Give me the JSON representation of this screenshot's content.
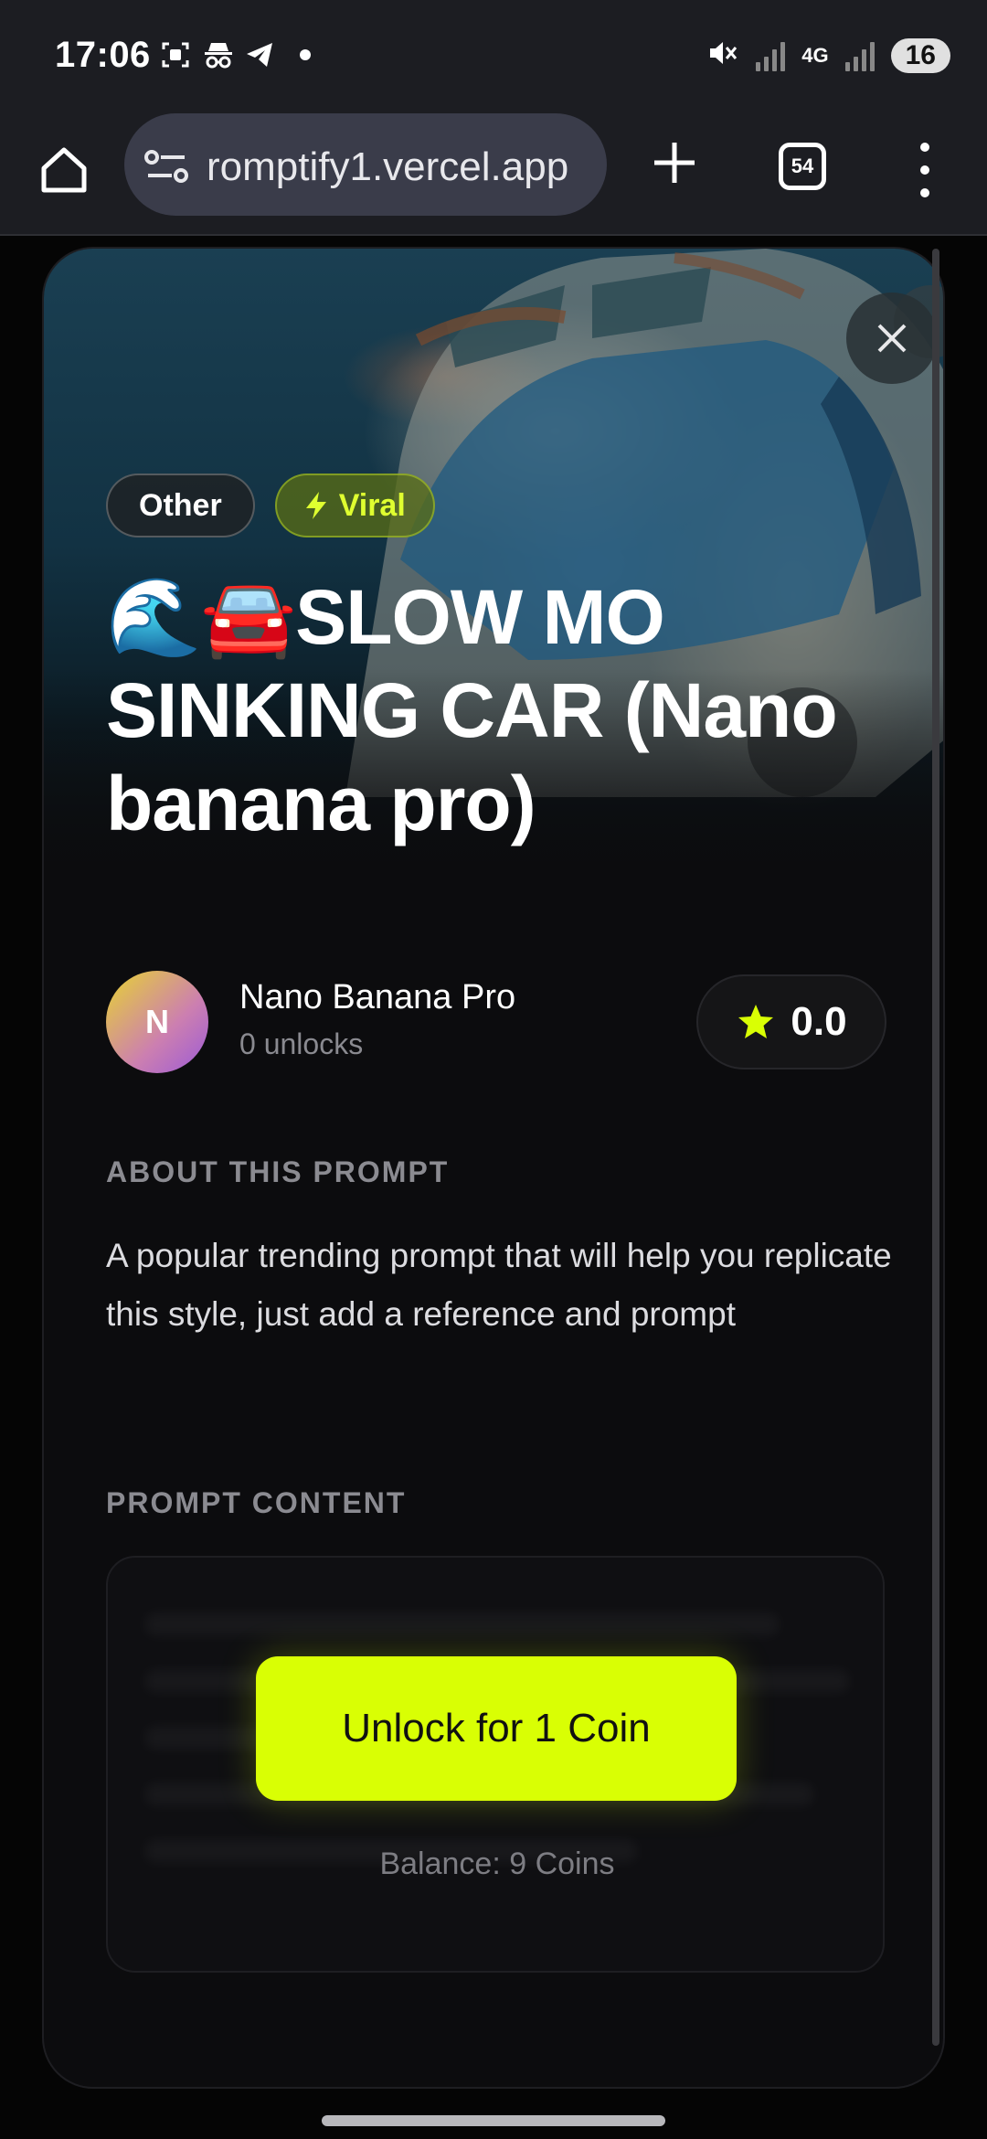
{
  "status_bar": {
    "time": "17:06",
    "network": "4G",
    "battery": "16"
  },
  "browser": {
    "url": "romptify1.vercel.app",
    "tab_count": "54"
  },
  "modal": {
    "tags": {
      "category": "Other",
      "badge": "Viral"
    },
    "title": "🌊🚘SLOW MO SINKING CAR (Nano banana pro)",
    "author": {
      "initial": "N",
      "name": "Nano Banana Pro",
      "unlocks": "0 unlocks"
    },
    "rating": "0.0",
    "about": {
      "label": "ABOUT THIS PROMPT",
      "text": "A popular trending prompt that will help you replicate this style, just add a reference and prompt"
    },
    "prompt_content": {
      "label": "PROMPT CONTENT",
      "unlock_label": "Unlock for 1 Coin",
      "balance": "Balance: 9 Coins"
    }
  },
  "colors": {
    "accent": "#d9ff04",
    "background": "#0c0c0e",
    "browser_bar": "#1c1d22"
  }
}
